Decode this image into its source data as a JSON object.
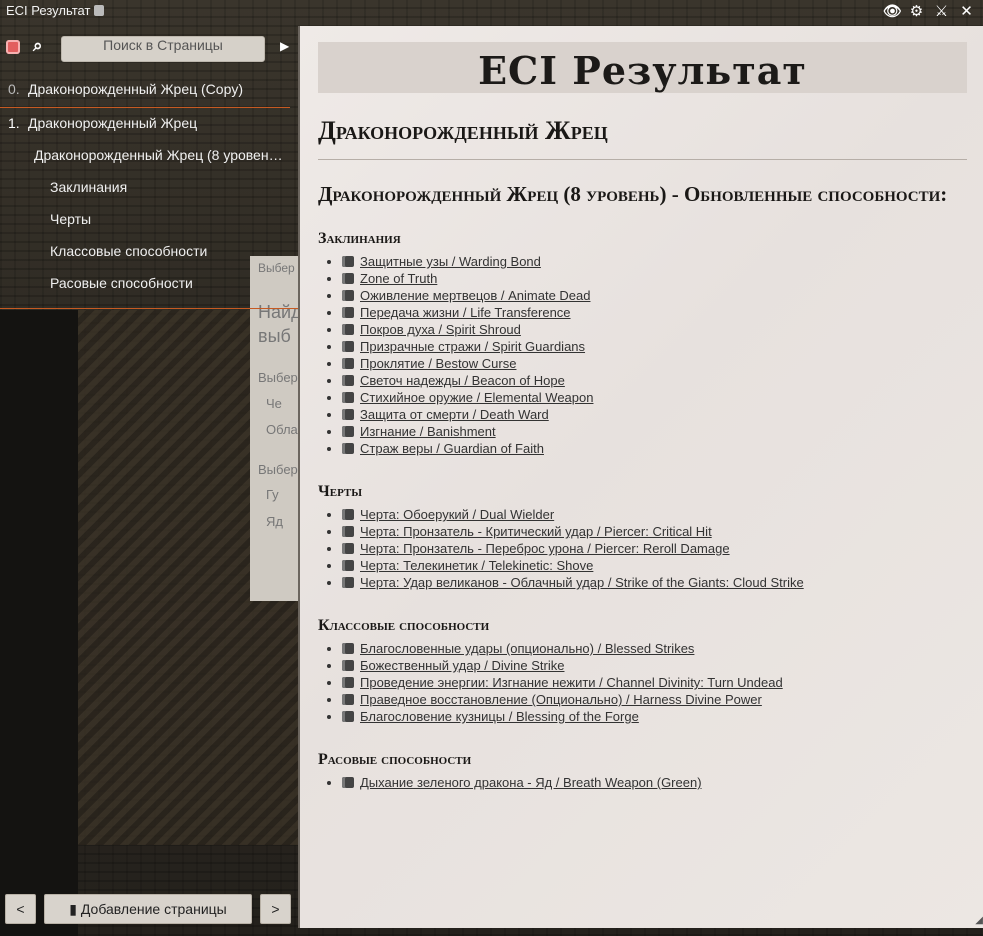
{
  "window": {
    "title": "ECI Результат"
  },
  "top_icons": [
    "eye-icon",
    "gear-icon",
    "crossed-swords-icon",
    "close-icon"
  ],
  "sidebar": {
    "search_placeholder": "Поиск в Страницы",
    "items": [
      {
        "num": "0.",
        "label": "Драконорожденный Жрец (Copy)"
      },
      {
        "num": "1.",
        "label": "Драконорожденный Жрец"
      },
      {
        "label": "Драконорожденный Жрец (8 уровен…"
      },
      {
        "label": "Заклинания"
      },
      {
        "label": "Черты"
      },
      {
        "label": "Классовые способности"
      },
      {
        "label": "Расовые способности"
      }
    ],
    "add_page": "Добавление страницы",
    "prev": "<",
    "next": ">"
  },
  "background_dialog": {
    "line1": "Выбер",
    "line2": "Найд",
    "line3": "выб",
    "line4": "Выбер",
    "line5": "Че",
    "line6": "Облач",
    "line7": "Выбер",
    "line8": "Гу",
    "line9": "Яд"
  },
  "panel": {
    "banner": "ECI Результат",
    "heading": "Драконорожденный Жрец",
    "subheading": "Драконорожденный Жрец (8 уровень) - Обновленные способности:",
    "sections": [
      {
        "title": "Заклинания",
        "items": [
          "Защитные узы / Warding Bond",
          "Zone of Truth",
          "Оживление мертвецов / Animate Dead",
          "Передача жизни / Life Transference",
          "Покров духа / Spirit Shroud",
          "Призрачные стражи / Spirit Guardians",
          "Проклятие / Bestow Curse",
          "Светоч надежды / Beacon of Hope",
          "Стихийное оружие / Elemental Weapon",
          "Защита от смерти / Death Ward",
          "Изгнание / Banishment",
          "Страж веры / Guardian of Faith"
        ]
      },
      {
        "title": "Черты",
        "items": [
          "Черта: Обоерукий / Dual Wielder",
          "Черта: Пронзатель - Критический удар / Piercer: Critical Hit",
          "Черта: Пронзатель - Переброс урона / Piercer: Reroll Damage",
          "Черта: Телекинетик / Telekinetic: Shove",
          "Черта: Удар великанов - Облачный удар / Strike of the Giants: Cloud Strike"
        ]
      },
      {
        "title": "Классовые способности",
        "items": [
          "Благословенные удары (опционально) / Blessed Strikes",
          "Божественный удар / Divine Strike",
          "Проведение энергии: Изгнание нежити / Channel Divinity: Turn Undead",
          "Праведное восстановление (Опционально) / Harness Divine Power",
          "Благословение кузницы / Blessing of the Forge"
        ]
      },
      {
        "title": "Расовые способности",
        "items": [
          "Дыхание зеленого дракона - Яд / Breath Weapon (Green)"
        ]
      }
    ]
  }
}
